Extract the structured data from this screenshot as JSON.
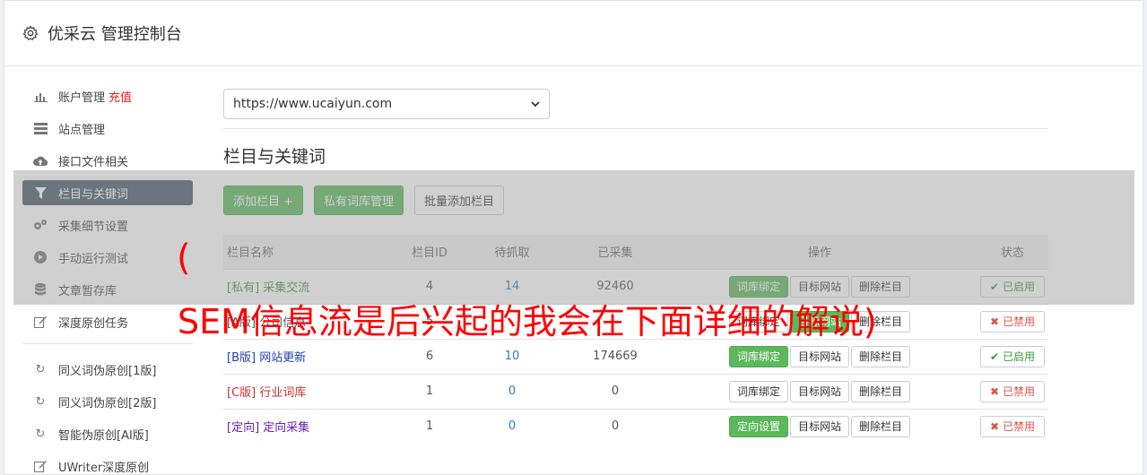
{
  "header": {
    "title": "优采云 管理控制台"
  },
  "sidebar": {
    "items": [
      {
        "label": "账户管理",
        "extra": "充值",
        "icon": "bar-chart-icon"
      },
      {
        "label": "站点管理",
        "icon": "server-icon"
      },
      {
        "label": "接口文件相关",
        "icon": "cloud-upload-icon"
      },
      {
        "label": "栏目与关键词",
        "icon": "filter-icon",
        "active": true
      },
      {
        "label": "采集细节设置",
        "icon": "cogs-icon"
      },
      {
        "label": "手动运行测试",
        "icon": "play-icon"
      },
      {
        "label": "文章暂存库",
        "icon": "database-icon"
      },
      {
        "label": "深度原创任务",
        "icon": "edit-icon"
      }
    ],
    "items2": [
      {
        "label": "同义词伪原创[1版]",
        "icon": "refresh-icon"
      },
      {
        "label": "同义词伪原创[2版]",
        "icon": "refresh-icon"
      },
      {
        "label": "智能伪原创[AI版]",
        "icon": "refresh-icon"
      },
      {
        "label": "UWriter深度原创",
        "icon": "edit-icon"
      }
    ]
  },
  "main": {
    "site_select": "https://www.ucaiyun.com",
    "section_title": "栏目与关键词",
    "buttons": {
      "add": "添加栏目 +",
      "private_lib": "私有词库管理",
      "batch_add": "批量添加栏目"
    },
    "table": {
      "headers": [
        "栏目名称",
        "栏目ID",
        "待抓取",
        "已采集",
        "操作",
        "状态"
      ],
      "rows": [
        {
          "prefix": "[私有]",
          "name": "采集交流",
          "id": "4",
          "pending": "14",
          "collected": "92460",
          "action1": "词库绑定",
          "action2": "目标网站",
          "action3": "删除栏目",
          "status": "已启用"
        },
        {
          "prefix": "[A版]",
          "name": "公司信息",
          "id": "5",
          "pending": "",
          "collected": "",
          "action1": "词库绑定",
          "action2": "目标网站",
          "action3": "删除栏目",
          "status": "已禁用"
        },
        {
          "prefix": "[B版]",
          "name": "网站更新",
          "id": "6",
          "pending": "10",
          "collected": "174669",
          "action1": "词库绑定",
          "action2": "目标网站",
          "action3": "删除栏目",
          "status": "已启用"
        },
        {
          "prefix": "[C版]",
          "name": "行业词库",
          "id": "1",
          "pending": "0",
          "collected": "0",
          "action1": "词库绑定",
          "action2": "目标网站",
          "action3": "删除栏目",
          "status": "已禁用"
        },
        {
          "prefix": "[定向]",
          "name": "定向采集",
          "id": "1",
          "pending": "0",
          "collected": "0",
          "action1": "定向设置",
          "action2": "目标网站",
          "action3": "删除栏目",
          "status": "已禁用"
        }
      ]
    }
  },
  "overlay": {
    "paren": "(",
    "text": "SEM信息流是后兴起的我会在下面详细的解说)"
  },
  "colors": {
    "green": "#5cb85c",
    "active_nav": "#4a5a6a",
    "overlay_text": "#ff0000"
  }
}
